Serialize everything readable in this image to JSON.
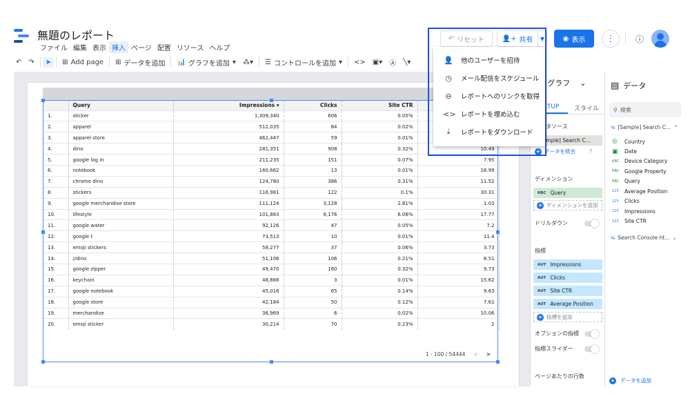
{
  "header": {
    "title": "無題のレポート",
    "menus": [
      "ファイル",
      "編集",
      "表示",
      "挿入",
      "ページ",
      "配置",
      "リソース",
      "ヘルプ"
    ],
    "active_menu": "挿入",
    "reset_label": "リセット",
    "share_label": "共有",
    "view_label": "表示"
  },
  "toolbar": {
    "add_page": "Add page",
    "add_data": "データを追加",
    "add_chart": "グラフを追加",
    "add_control": "コントロールを追加"
  },
  "share_menu": {
    "items": [
      {
        "label": "他のユーザーを招待",
        "icon": "person-add-icon"
      },
      {
        "label": "メール配信をスケジュール",
        "icon": "clock-icon"
      },
      {
        "label": "レポートへのリンクを取得",
        "icon": "link-icon"
      },
      {
        "label": "レポートを埋め込む",
        "icon": "code-icon"
      },
      {
        "label": "レポートをダウンロード",
        "icon": "download-icon"
      }
    ]
  },
  "table": {
    "headers": [
      "Query",
      "Impressions ▾",
      "Clicks",
      "Site CTR",
      ""
    ],
    "rows": [
      [
        "1.",
        "sticker",
        "1,309,340",
        "606",
        "0.05%",
        ""
      ],
      [
        "2.",
        "apparel",
        "512,035",
        "84",
        "0.02%",
        ""
      ],
      [
        "3.",
        "apparel store",
        "462,447",
        "59",
        "0.01%",
        ""
      ],
      [
        "4.",
        "dino",
        "281,351",
        "908",
        "0.32%",
        "10.49"
      ],
      [
        "5.",
        "google log in",
        "211,235",
        "151",
        "0.07%",
        "7.95"
      ],
      [
        "6.",
        "notebook",
        "160,662",
        "13",
        "0.01%",
        "16.99"
      ],
      [
        "7.",
        "chrome dino",
        "124,780",
        "386",
        "0.31%",
        "11.52"
      ],
      [
        "8.",
        "stickers",
        "116,981",
        "122",
        "0.1%",
        "30.31"
      ],
      [
        "9.",
        "google merchandise store",
        "111,124",
        "3,128",
        "2.81%",
        "1.03"
      ],
      [
        "10.",
        "lifestyle",
        "101,883",
        "6,176",
        "6.06%",
        "17.77"
      ],
      [
        "11.",
        "google water",
        "92,126",
        "47",
        "0.05%",
        "7.2"
      ],
      [
        "12.",
        "google t",
        "73,513",
        "10",
        "0.01%",
        "11.4"
      ],
      [
        "13.",
        "emoji stickers",
        "58,277",
        "37",
        "0.06%",
        "3.73"
      ],
      [
        "14.",
        "//dino",
        "51,106",
        "106",
        "0.21%",
        "8.51"
      ],
      [
        "15.",
        "google zipper",
        "49,470",
        "160",
        "0.32%",
        "9.73"
      ],
      [
        "16.",
        "keychain",
        "48,888",
        "3",
        "0.01%",
        "15.62"
      ],
      [
        "17.",
        "google notebook",
        "45,016",
        "65",
        "0.14%",
        "9.63"
      ],
      [
        "18.",
        "google store",
        "42,184",
        "50",
        "0.12%",
        "7.61"
      ],
      [
        "19.",
        "merchandise",
        "36,969",
        "6",
        "0.02%",
        "10.06"
      ],
      [
        "20.",
        "emoji sticker",
        "30,214",
        "70",
        "0.23%",
        "2"
      ]
    ],
    "pagination": "1 - 100 / 54444"
  },
  "setup_panel": {
    "chart_label": "グラフ",
    "tab_setup": "SETUP",
    "tab_style": "スタイル",
    "datasource_label": "データソース",
    "datasource_value": "[Sample] Search C...",
    "blend_label": "データを統合",
    "dimension_label": "ディメンション",
    "dimension_value": "Query",
    "add_dimension": "ディメンションを追加",
    "drilldown_label": "ドリルダウン",
    "metrics_label": "指標",
    "metrics": [
      "Impressions",
      "Clicks",
      "Site CTR",
      "Average Position"
    ],
    "add_metric": "指標を追加",
    "optional_metrics_label": "オプションの指標",
    "metric_slider_label": "指標スライダー",
    "rows_per_page_label": "ページあたりの行数"
  },
  "data_panel": {
    "title": "データ",
    "search_placeholder": "検索",
    "source1": "[Sample] Search C...",
    "fields": [
      {
        "name": "Country",
        "type": "globe"
      },
      {
        "name": "Date",
        "type": "calendar"
      },
      {
        "name": "Device Category",
        "type": "ABC"
      },
      {
        "name": "Google Property",
        "type": "ABC"
      },
      {
        "name": "Query",
        "type": "ABC"
      },
      {
        "name": "Average Position",
        "type": "123"
      },
      {
        "name": "Clicks",
        "type": "123"
      },
      {
        "name": "Impressions",
        "type": "123"
      },
      {
        "name": "Site CTR",
        "type": "123"
      }
    ],
    "source2": "Search Console ht...",
    "add_data": "データを追加"
  }
}
